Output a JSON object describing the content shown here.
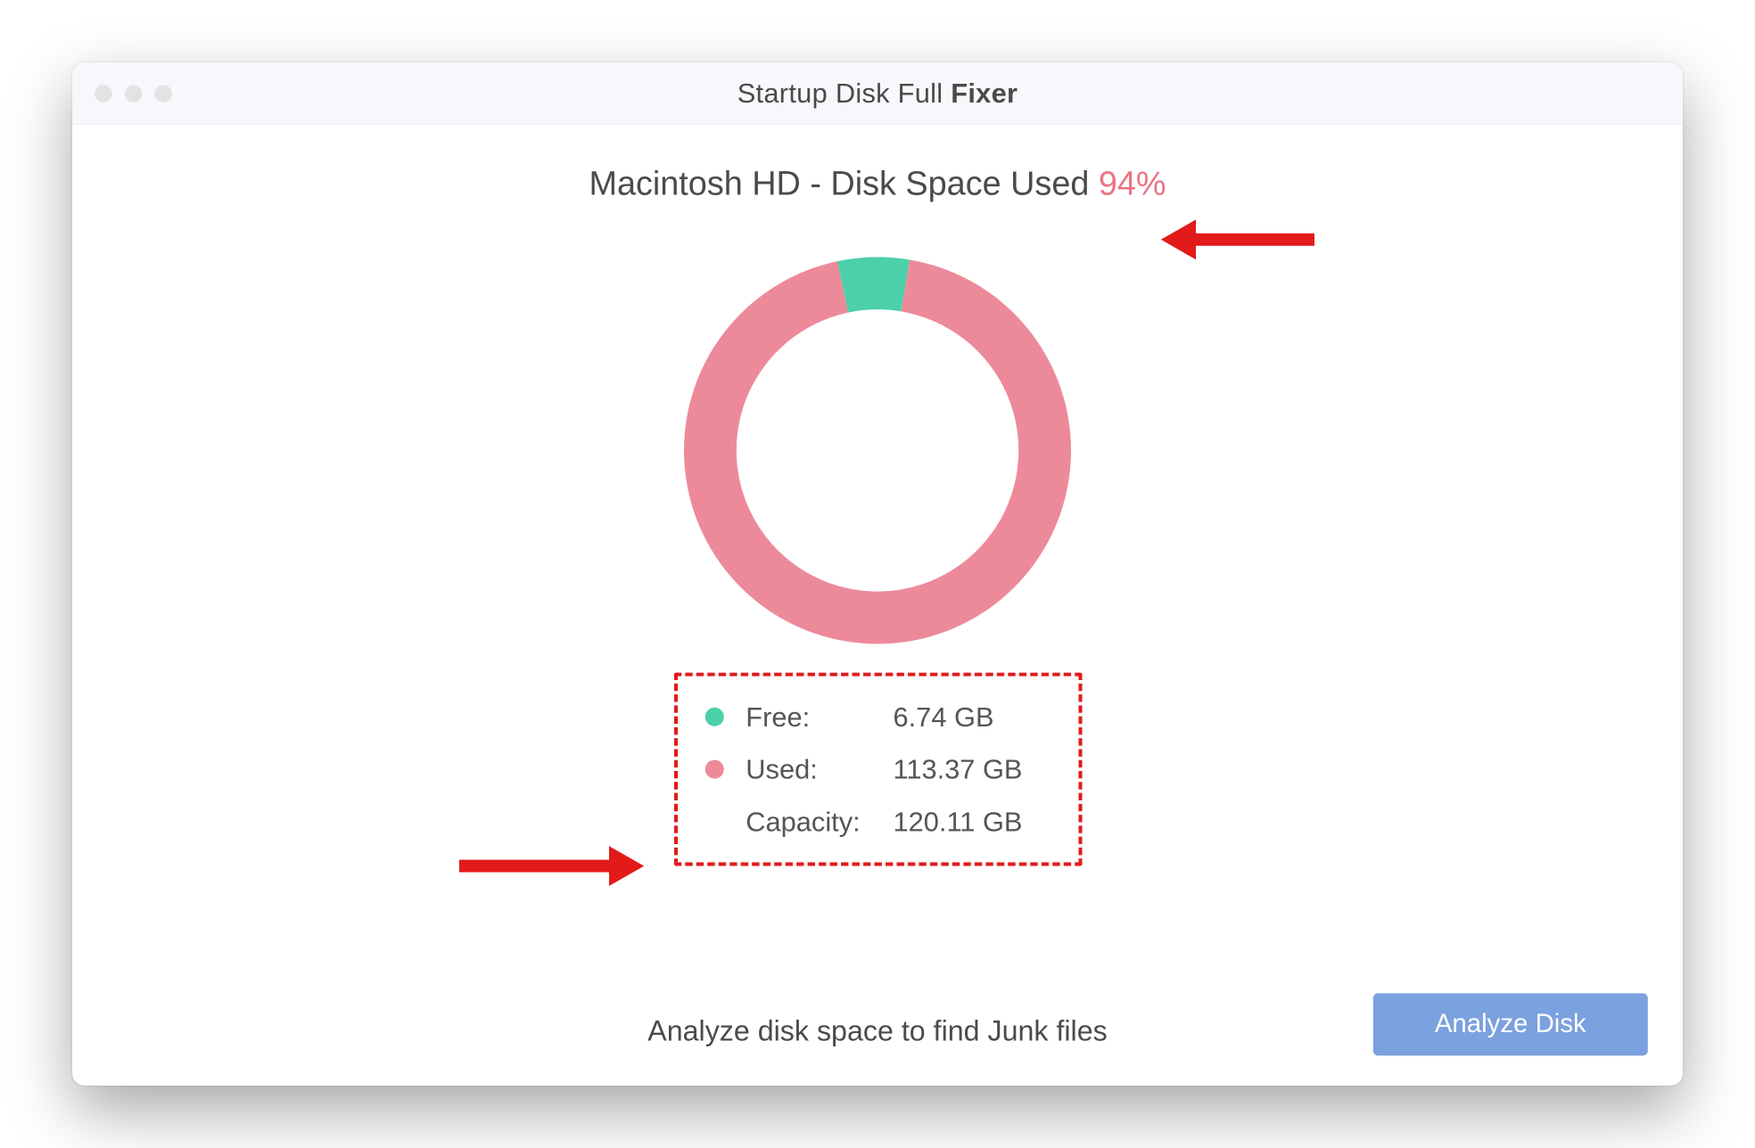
{
  "window": {
    "title_light": "Startup Disk Full ",
    "title_bold": "Fixer"
  },
  "headline": {
    "text_prefix": "Macintosh HD - Disk Space Used ",
    "percent": "94%"
  },
  "chart_data": {
    "type": "pie",
    "title": "Disk Space Used",
    "series": [
      {
        "name": "Used",
        "value": 113.37,
        "unit": "GB",
        "color": "#ed8a9a",
        "percent": 94
      },
      {
        "name": "Free",
        "value": 6.74,
        "unit": "GB",
        "color": "#4cd0a9",
        "percent": 6
      }
    ],
    "capacity": 120.11,
    "donut_start_angle_deg": -12,
    "colors": {
      "used": "#ed8a9a",
      "free": "#4cd0a9",
      "annotation": "#e21a1a",
      "button": "#7ba1de"
    }
  },
  "legend": {
    "free_label": "Free:",
    "free_value": "6.74 GB",
    "used_label": "Used:",
    "used_value": "113.37 GB",
    "capacity_label": "Capacity:",
    "capacity_value": "120.11 GB"
  },
  "prompt_text": "Analyze disk space to find Junk files",
  "analyze_button_label": "Analyze Disk"
}
